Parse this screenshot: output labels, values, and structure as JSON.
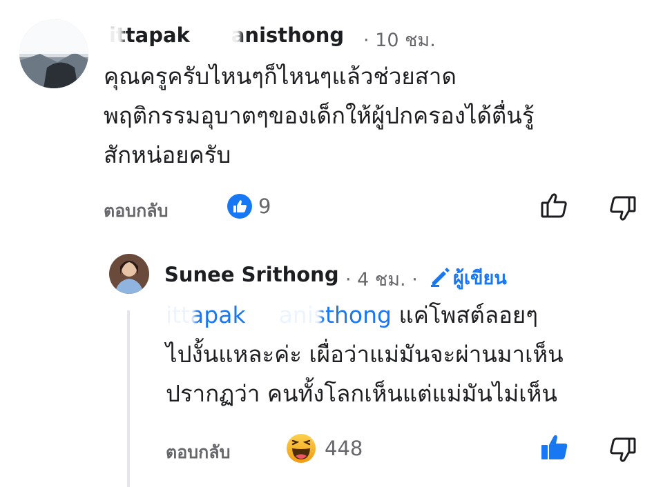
{
  "comment": {
    "author": "Kittapak Thanisthong",
    "author_display_left": "ittapak",
    "author_display_right": "anisthong",
    "time": "· 10 ชม.",
    "text_lines": [
      "คุณครูครับไหนๆก็ไหนๆแล้วช่วยสาด",
      "พฤติกรรมอุบาตๆของเด็กให้ผู้ปกครองได้ตื่นรู้",
      "สักหน่อยครับ"
    ],
    "reply_label": "ตอบกลับ",
    "reaction_count": "9",
    "reaction_icon": "like-reaction-icon"
  },
  "reply": {
    "author": "Sunee Srithong",
    "time": "· 4 ชม. ·",
    "author_badge": "ผู้เขียน",
    "mention_left": "ittapak",
    "mention_right": "anisthong",
    "text_lines": [
      " แค่โพสต์ลอยๆ",
      "ไปงั้นแหละค่ะ เผื่อว่าแม่มันจะผ่านมาเห็น",
      "ปรากฏว่า คนทั้งโลกเห็นแต่แม่มันไม่เห็น"
    ],
    "reply_label": "ตอบกลับ",
    "reaction_count": "448",
    "reaction_icon": "haha-reaction-icon"
  },
  "colors": {
    "like_blue": "#1877f2",
    "haha_yellow": "#f7b125",
    "gray_text": "#65676b"
  }
}
